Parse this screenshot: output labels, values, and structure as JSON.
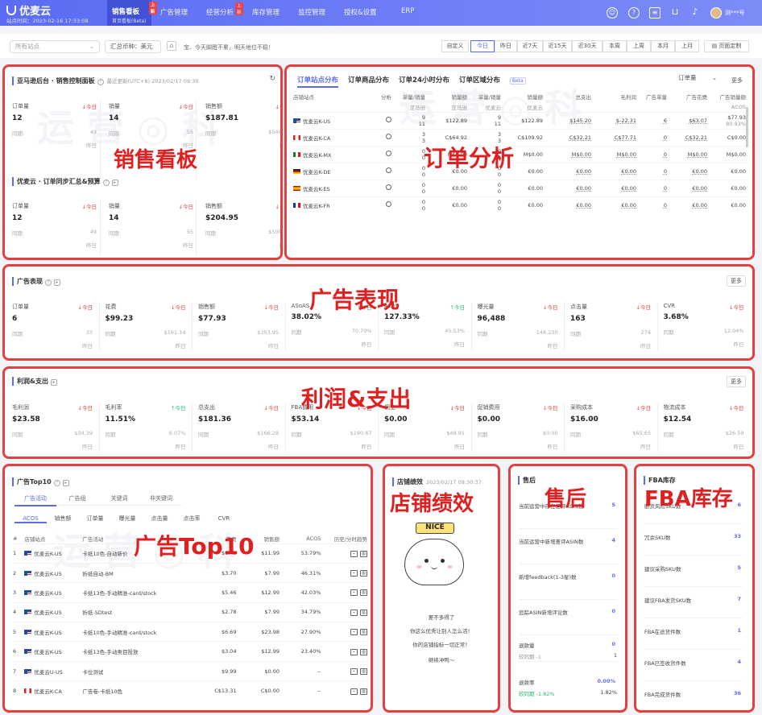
{
  "nav": {
    "logo": "优麦云",
    "site_time": "站点时间：2023-02-16 17:33:08",
    "tabs": [
      {
        "label": "销售看板",
        "sub": "首页看板(Beta)",
        "badge": "上新"
      },
      {
        "label": "广告管理"
      },
      {
        "label": "经营分析",
        "badge": "上新"
      },
      {
        "label": "库存管理"
      },
      {
        "label": "监控管理"
      },
      {
        "label": "授权&设置"
      },
      {
        "label": "ERP"
      }
    ],
    "user": "测***号"
  },
  "filter": {
    "shop_placeholder": "所有站点",
    "currency": "汇总币种：美元",
    "marquee": "宝、今天脚蹬不累，明天地位不稳！",
    "dates": [
      "自定义",
      "今日",
      "昨日",
      "近7天",
      "近15天",
      "近30天",
      "本周",
      "上周",
      "本月",
      "上月"
    ],
    "active_date": "今日",
    "custom_page": "页面定制"
  },
  "watermark": "运 营 ◎ 科",
  "annotations": {
    "sales": "销售看板",
    "orders": "订单分析",
    "ads": "广告表现",
    "profit": "利润&支出",
    "top10": "广告Top10",
    "perf": "店铺绩效",
    "after": "售后",
    "fba": "FBA库存"
  },
  "sales": {
    "title": "亚马逊后台 · 销售控制面板",
    "updated": "最近更新(UTC+8) 2023/02/17 09:30",
    "m1": [
      {
        "k": "订单量",
        "t": "↓今日",
        "v": "12",
        "p": "同期",
        "pv": "49",
        "y": "昨日"
      },
      {
        "k": "销量",
        "t": "↓今日",
        "v": "14",
        "p": "同期",
        "pv": "55",
        "y": "昨日"
      },
      {
        "k": "销售额",
        "t": "↓今日",
        "v": "$187.81",
        "p": "同期",
        "pv": "$540.32",
        "y": "昨日"
      }
    ],
    "title2": "优麦云 · 订单同步汇总&预算",
    "m2": [
      {
        "k": "订单量",
        "t": "↓今日",
        "v": "12",
        "p": "同期",
        "pv": "49",
        "y": "昨日"
      },
      {
        "k": "销量",
        "t": "↓今日",
        "v": "14",
        "p": "同期",
        "pv": "55",
        "y": "昨日"
      },
      {
        "k": "销售额",
        "t": "↓今日",
        "v": "$204.95",
        "p": "同期",
        "pv": "$500.60",
        "y": "昨日"
      }
    ]
  },
  "orders": {
    "tabs": [
      "订单站点分布",
      "订单商品分布",
      "订单24小时分布",
      "订单区域分布"
    ],
    "beta": "Beta",
    "metric": "订单量",
    "more": "更多",
    "headers": [
      "店铺站点",
      "分析",
      "单量/销量",
      "销量额",
      "单量/销量",
      "销量额",
      "总支出",
      "毛利润",
      "广告单量",
      "广告花费",
      "广告销量额"
    ],
    "sub": [
      "",
      "",
      "亚马逊",
      "亚马逊",
      "优麦云",
      "优麦云",
      "",
      "",
      "",
      "",
      "ACOS"
    ],
    "rows": [
      {
        "flag": "us",
        "shop": "优麦云K-US",
        "a": "9",
        "b": "11",
        "c": "$122.89",
        "d": "9",
        "e": "11",
        "f": "$122.89",
        "g": "$145.20",
        "h": "$-22.31",
        "i": "6",
        "j": "$63.07",
        "k": "$77.93",
        "k2": "80.93%"
      },
      {
        "flag": "ca",
        "shop": "优麦云K-CA",
        "a": "3",
        "b": "3",
        "c": "C$64.92",
        "d": "3",
        "e": "3",
        "f": "C$109.92",
        "g": "C$32.21",
        "h": "C$77.71",
        "i": "0",
        "j": "C$32.21",
        "k": "C$0.00",
        "k2": ""
      },
      {
        "flag": "mx",
        "shop": "优麦云K-MX",
        "a": "0",
        "b": "0",
        "c": "M$0.00",
        "d": "0",
        "e": "0",
        "f": "M$0.00",
        "g": "M$0.00",
        "h": "M$0.00",
        "i": "0",
        "j": "M$0.00",
        "k": "M$0.00",
        "k2": ""
      },
      {
        "flag": "de",
        "shop": "优麦云K-DE",
        "a": "0",
        "b": "0",
        "c": "€0.00",
        "d": "0",
        "e": "0",
        "f": "€0.00",
        "g": "€0.00",
        "h": "€0.00",
        "i": "0",
        "j": "€0.00",
        "k": "€0.00",
        "k2": ""
      },
      {
        "flag": "es",
        "shop": "优麦云K-ES",
        "a": "0",
        "b": "0",
        "c": "€0.00",
        "d": "0",
        "e": "0",
        "f": "€0.00",
        "g": "€0.00",
        "h": "€0.00",
        "i": "0",
        "j": "€0.00",
        "k": "€0.00",
        "k2": ""
      },
      {
        "flag": "fr",
        "shop": "优麦云K-FR",
        "a": "0",
        "b": "0",
        "c": "€0.00",
        "d": "0",
        "e": "0",
        "f": "€0.00",
        "g": "€0.00",
        "h": "€0.00",
        "i": "0",
        "j": "€0.00",
        "k": "€0.00",
        "k2": ""
      }
    ]
  },
  "ads": {
    "title": "广告表现",
    "more": "更多",
    "metrics": [
      {
        "k": "订单量",
        "t": "↓今日",
        "v": "6",
        "pv": "33"
      },
      {
        "k": "花费",
        "t": "↓今日",
        "v": "$99.23",
        "pv": "$161.14"
      },
      {
        "k": "销售额",
        "t": "↓今日",
        "v": "$77.93",
        "pv": "$353.95"
      },
      {
        "k": "ASoAS",
        "t": "↑今日",
        "v": "38.02%",
        "pv": "70.70%"
      },
      {
        "k": "ACoS",
        "t": "↑今日",
        "v": "127.33%",
        "pv": "45.53%"
      },
      {
        "k": "曝光量",
        "t": "↓今日",
        "v": "96,488",
        "pv": "148,230"
      },
      {
        "k": "点击量",
        "t": "↓今日",
        "v": "163",
        "pv": "274"
      },
      {
        "k": "CVR",
        "t": "↓今日",
        "v": "3.68%",
        "pv": "12.04%"
      }
    ],
    "p": "同期",
    "y": "昨日"
  },
  "profit": {
    "title": "利润&支出",
    "more": "更多",
    "metrics": [
      {
        "k": "毛利润",
        "t": "↓今日",
        "v": "$23.58",
        "pv": "$34.39"
      },
      {
        "k": "毛利率",
        "t": "↑今日",
        "v": "11.51%",
        "pv": "6.07%"
      },
      {
        "k": "总支出",
        "t": "↓今日",
        "v": "$181.36",
        "pv": "$166.28"
      },
      {
        "k": "FBA费用",
        "t": "↓今日",
        "v": "$53.14",
        "pv": "$190.67"
      },
      {
        "k": "佣金",
        "t": "↓今日",
        "v": "$0.00",
        "pv": "$48.91"
      },
      {
        "k": "促销费用",
        "t": "↓今日",
        "v": "$0.00",
        "pv": "$0.00"
      },
      {
        "k": "采购成本",
        "t": "↓今日",
        "v": "$16.00",
        "pv": "$65.65"
      },
      {
        "k": "物流成本",
        "t": "↓今日",
        "v": "$12.54",
        "pv": "$26.59"
      }
    ],
    "p": "同期",
    "y": "昨日"
  },
  "top10": {
    "title": "广告Top10",
    "subtabs": [
      "广告活动",
      "广告组",
      "关键词",
      "非关键词"
    ],
    "mtabs": [
      "ACOS",
      "销售额",
      "订单量",
      "曝光量",
      "点击量",
      "点击率",
      "CVR"
    ],
    "headers": [
      "#",
      "店铺站点",
      "广告活动",
      "花费",
      "销售额",
      "ACOS",
      "历史/分时趋势"
    ],
    "rows": [
      {
        "n": "1",
        "flag": "us",
        "shop": "优麦云K-US",
        "camp": "卡纸10色-自动新价",
        "cost": "$6.45",
        "sales": "$11.99",
        "acos": "53.79%"
      },
      {
        "n": "2",
        "flag": "us",
        "shop": "优麦云K-US",
        "camp": "折纸自动-BM",
        "cost": "$3.70",
        "sales": "$7.99",
        "acos": "46.31%"
      },
      {
        "n": "3",
        "flag": "us",
        "shop": "优麦云K-US",
        "camp": "卡纸13色-手动精准-card/stock",
        "cost": "$5.46",
        "sales": "$12.99",
        "acos": "42.03%"
      },
      {
        "n": "4",
        "flag": "us",
        "shop": "优麦云K-US",
        "camp": "折纸-SDtest",
        "cost": "$2.78",
        "sales": "$7.99",
        "acos": "34.79%"
      },
      {
        "n": "5",
        "flag": "us",
        "shop": "优麦云K-US",
        "camp": "卡纸10色-手动精准-card/stock",
        "cost": "$6.69",
        "sales": "$23.98",
        "acos": "27.90%"
      },
      {
        "n": "6",
        "flag": "us",
        "shop": "优麦云K-US",
        "camp": "卡纸13色-手动类目投放",
        "cost": "$3.04",
        "sales": "$12.99",
        "acos": "23.40%"
      },
      {
        "n": "7",
        "flag": "us",
        "shop": "优麦云U-US",
        "camp": "卡位测试",
        "cost": "$9.99",
        "sales": "$0.00",
        "acos": "--"
      },
      {
        "n": "8",
        "flag": "ca",
        "shop": "优麦云K-CA",
        "camp": "广告卷-卡纸10色",
        "cost": "C$13.31",
        "sales": "C$0.00",
        "acos": "--"
      }
    ]
  },
  "perf": {
    "title": "店铺绩效",
    "updated": "2023/02/17 09:30:37",
    "nice": "NICE",
    "l1": "差不多得了",
    "l2": "你这么优秀让别人怎么活！",
    "l3": "你的店铺指标一切正常！",
    "l4": "继续冲鸭～"
  },
  "after": {
    "title": "售后",
    "rows": [
      {
        "k": "当前运营中存在差评ASIN数",
        "v": "5"
      },
      {
        "k": "当前运营中新增差评ASIN数",
        "v": "4"
      },
      {
        "k": "新增feedback(1-3星)数",
        "v": "0"
      },
      {
        "k": "追踪ASIN新增评论数",
        "v": "0"
      }
    ],
    "ret_k": "退款量",
    "ret_v": "0",
    "ret_p": "较同期 -1",
    "ret_p2": "1",
    "rate_k": "退款率",
    "rate_v": "0.00%",
    "rate_p": "较同期 -1.82%",
    "rate_p2": "1.82%"
  },
  "fba": {
    "title": "FBA库存",
    "rows": [
      {
        "k": "断货风险SKU数",
        "v": "6"
      },
      {
        "k": "冗余SKU数",
        "v": "33"
      },
      {
        "k": "建议采购SKU数",
        "v": "5"
      },
      {
        "k": "建议FBA发货SKU数",
        "v": "7"
      },
      {
        "k": "FBA在途货件数",
        "v": "1"
      },
      {
        "k": "FBA已签收货件数",
        "v": "4"
      },
      {
        "k": "FBA完成货件数",
        "v": "36"
      }
    ]
  }
}
